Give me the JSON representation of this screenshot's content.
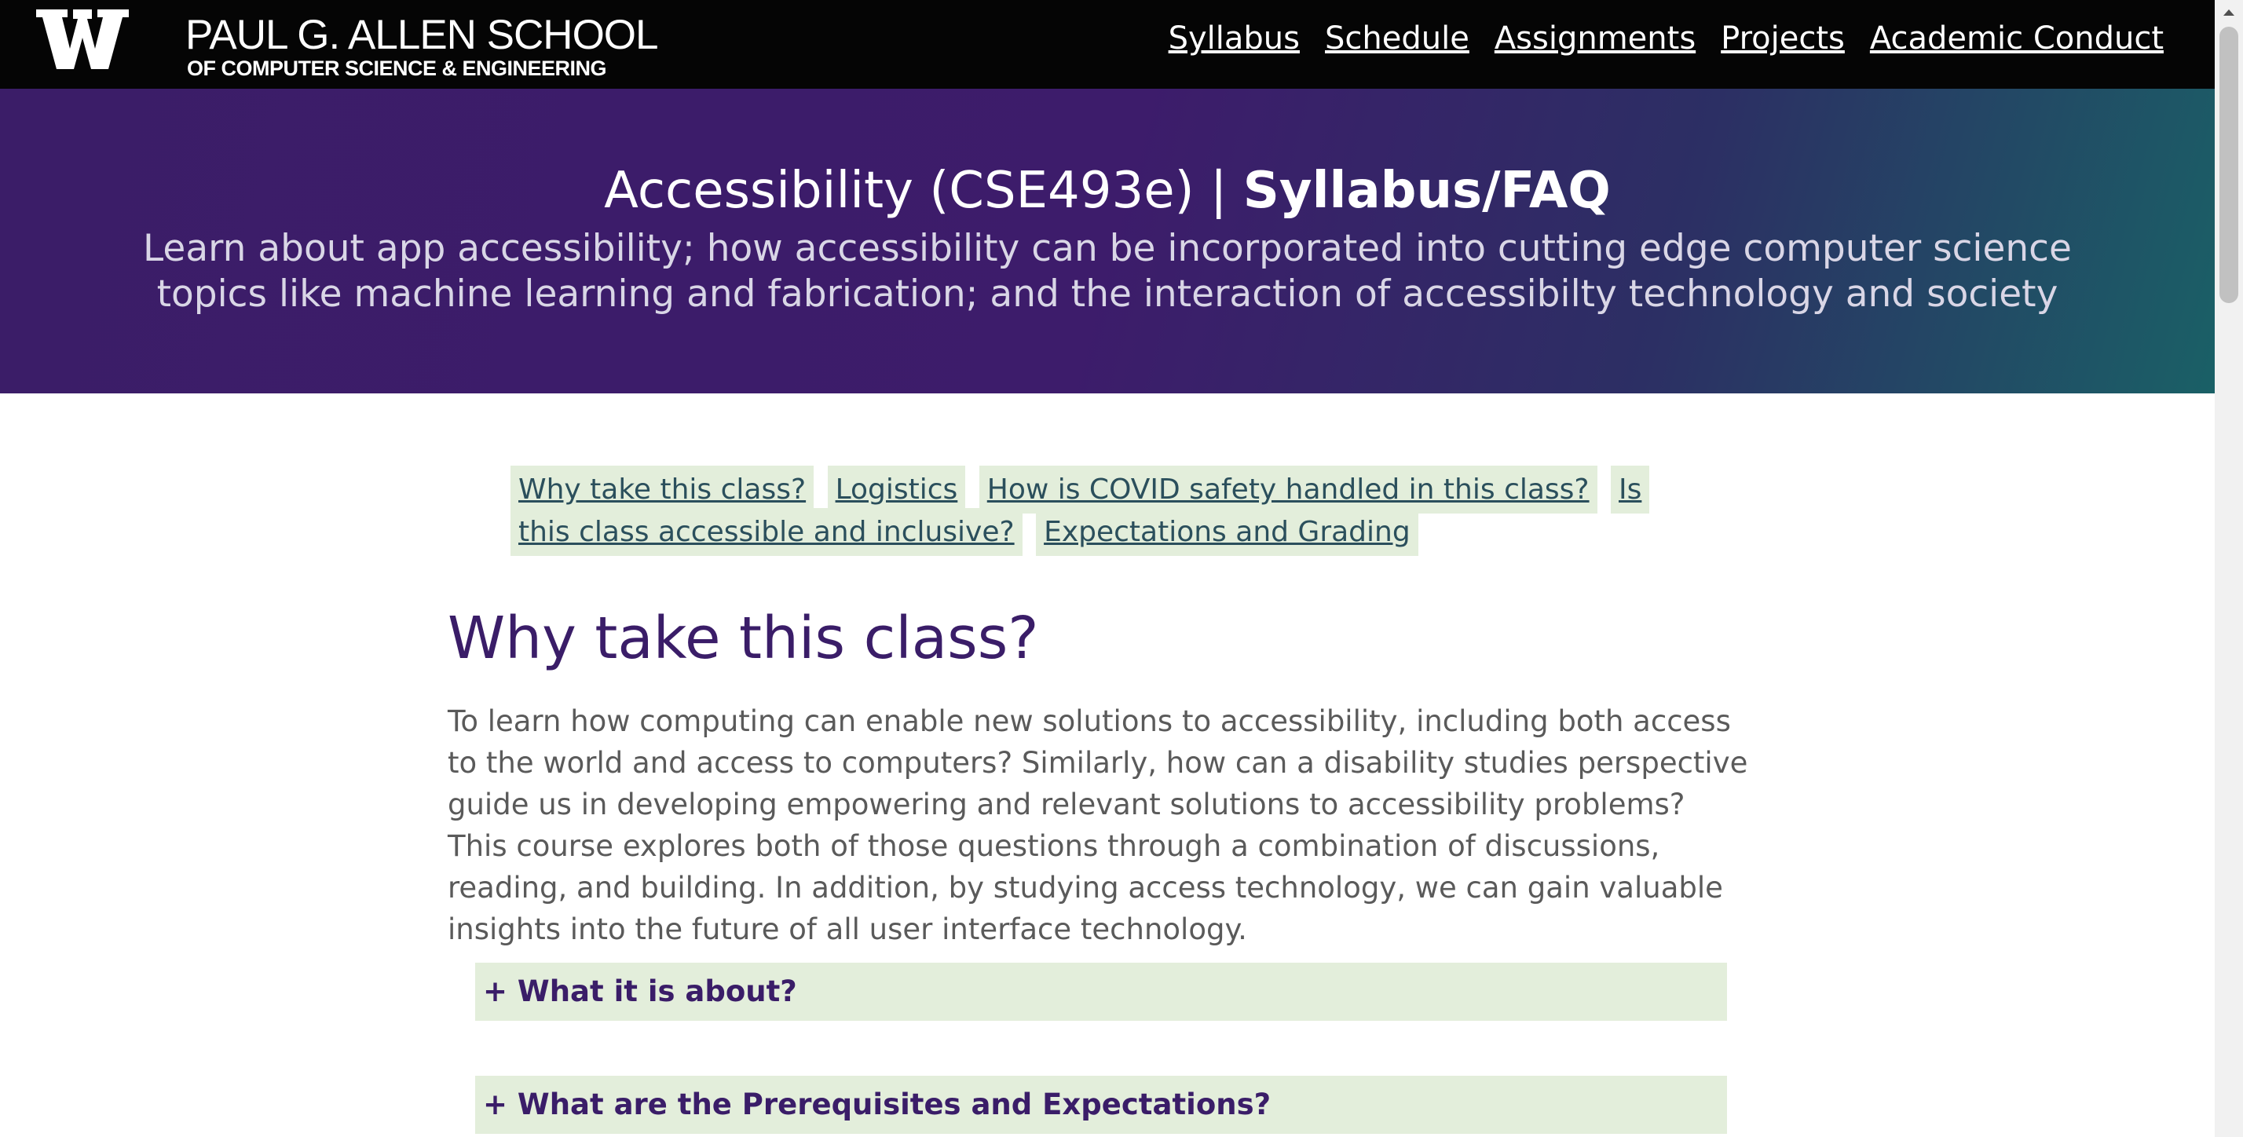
{
  "header": {
    "logo_line1": "PAUL G. ALLEN SCHOOL",
    "logo_line2": "OF COMPUTER SCIENCE & ENGINEERING",
    "nav": [
      "Syllabus",
      "Schedule",
      "Assignments",
      "Projects",
      "Academic Conduct"
    ]
  },
  "hero": {
    "title_main": "Accessibility (CSE493e) | ",
    "title_strong": "Syllabus/FAQ",
    "subtitle": "Learn about app accessibility; how accessibility can be incorporated into cutting edge computer science topics like machine learning and fabrication; and the interaction of accessibilty technology and society"
  },
  "toc": [
    "Why take this class?",
    "Logistics",
    "How is COVID safety handled in this class?",
    "Is this class accessible and inclusive?",
    "Expectations and Grading"
  ],
  "section": {
    "title": "Why take this class?",
    "body": "To learn how computing can enable new solutions to accessibility, including both access to the world and access to computers? Similarly, how can a disability studies perspective guide us in developing empowering and relevant solutions to accessibility problems? This course explores both of those questions through a combination of discussions, reading, and building. In addition, by studying access technology, we can gain valuable insights into the future of all user interface technology."
  },
  "accordions": [
    "+ What it is about?",
    "+ What are the Prerequisites and Expectations?"
  ],
  "colors": {
    "accent_purple": "#3a1d68",
    "toc_background": "#e3eedb",
    "topbar": "#050505"
  }
}
